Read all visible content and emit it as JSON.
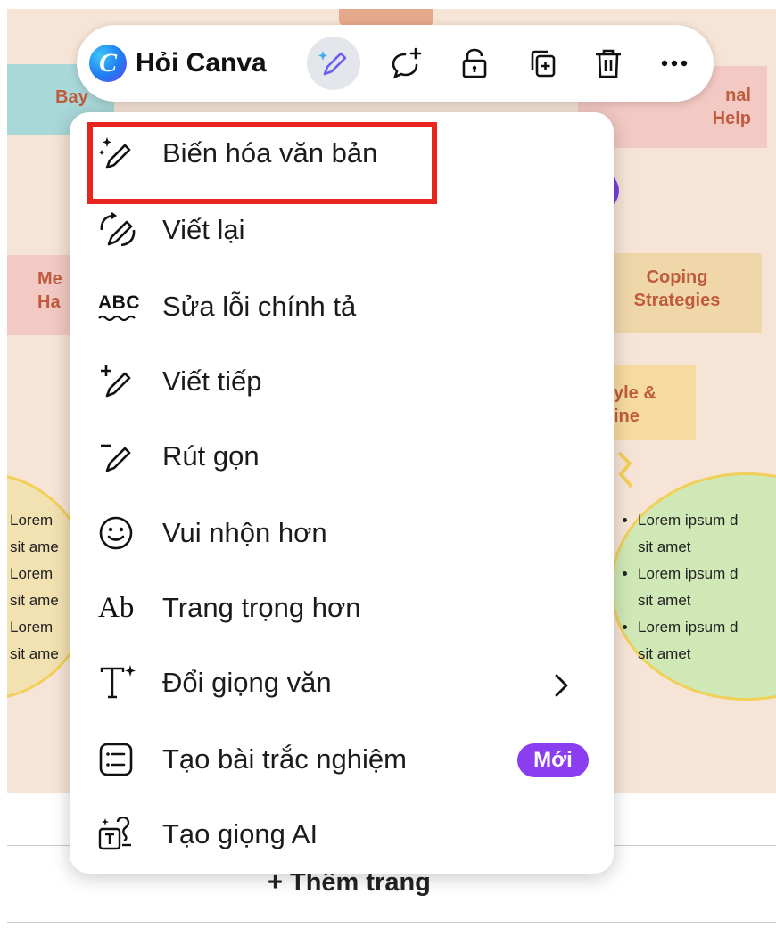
{
  "canvas": {
    "notes": {
      "top_left": "Bay",
      "top_right": "nal\nHelp",
      "mid_left": "Me\nHa",
      "mid_right": "Coping\nStrategies",
      "lower_right": "yle &\nine"
    },
    "bubble_left_lines": [
      "Lorem",
      "sit ame",
      "Lorem",
      "sit ame",
      "Lorem",
      "sit ame"
    ],
    "bubble_right_items": [
      {
        "line1": "Lorem ipsum d",
        "line2": "sit amet"
      },
      {
        "line1": "Lorem ipsum d",
        "line2": "sit amet"
      },
      {
        "line1": "Lorem ipsum d",
        "line2": "sit amet"
      }
    ]
  },
  "toolbar": {
    "ask_label": "Hỏi Canva",
    "logo_letter": "C",
    "buttons": [
      "magic-write-icon",
      "comment-add-icon",
      "unlock-icon",
      "duplicate-icon",
      "trash-icon",
      "more-icon"
    ]
  },
  "menu": {
    "items": [
      {
        "label": "Biến hóa văn bản",
        "icon": "magic-pen-icon"
      },
      {
        "label": "Viết lại",
        "icon": "rewrite-icon"
      },
      {
        "label": "Sửa lỗi chính tả",
        "icon": "spellcheck-icon",
        "icon_text": "ABC"
      },
      {
        "label": "Viết tiếp",
        "icon": "continue-writing-icon"
      },
      {
        "label": "Rút gọn",
        "icon": "shorten-icon"
      },
      {
        "label": "Vui nhộn hơn",
        "icon": "smiley-icon"
      },
      {
        "label": "Trang trọng hơn",
        "icon": "formal-icon",
        "icon_text": "Ab"
      },
      {
        "label": "Đổi giọng văn",
        "icon": "text-style-icon"
      },
      {
        "label": "Tạo bài trắc nghiệm",
        "icon": "quiz-icon",
        "badge": "Mới"
      },
      {
        "label": "Tạo giọng AI",
        "icon": "ai-voice-icon"
      }
    ]
  },
  "bottom": {
    "add_page": "+ Thêm trang"
  },
  "colors": {
    "highlight": "#e8251e",
    "badge": "#8b3df0",
    "canvas_bg": "#f6e4d6"
  }
}
